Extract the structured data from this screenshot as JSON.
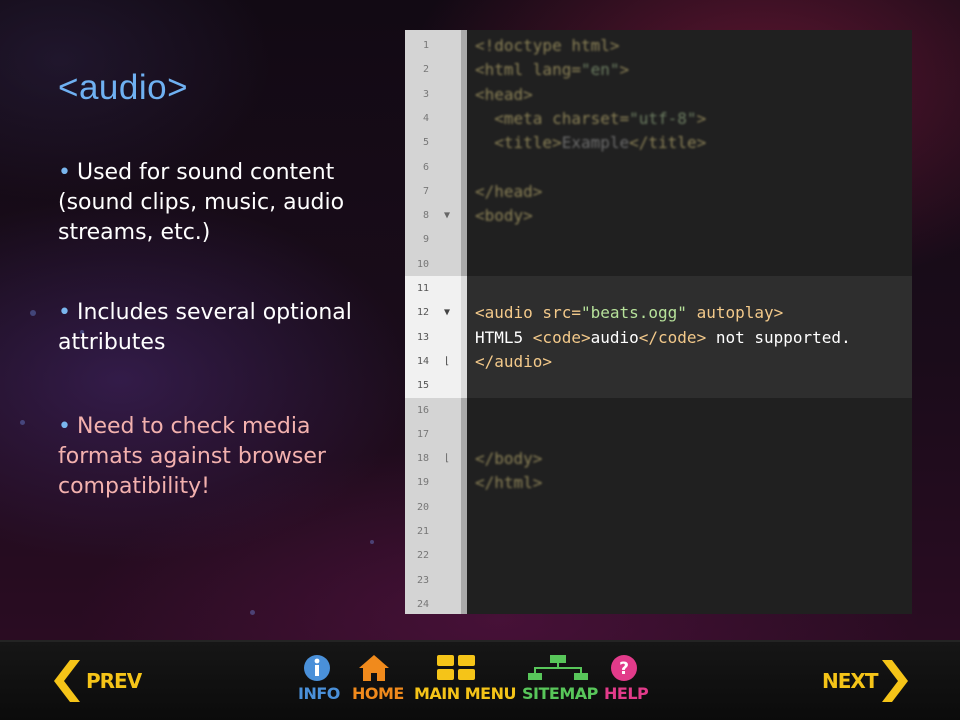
{
  "slide": {
    "title": "<audio>",
    "bullets": [
      {
        "text": "Used for sound content (sound clips, music, audio streams, etc.)"
      },
      {
        "text": "Includes several optional attributes"
      },
      {
        "text": "Need to check media formats against browser compatibility!"
      }
    ]
  },
  "code": {
    "lines": [
      {
        "n": "1",
        "fold": "",
        "text": "<!doctype html>"
      },
      {
        "n": "2",
        "fold": "",
        "text": "<html lang=\"en\">"
      },
      {
        "n": "3",
        "fold": "",
        "text": "<head>"
      },
      {
        "n": "4",
        "fold": "",
        "text": "  <meta charset=\"utf-8\">"
      },
      {
        "n": "5",
        "fold": "",
        "text": "  <title>Example</title>"
      },
      {
        "n": "6",
        "fold": "",
        "text": ""
      },
      {
        "n": "7",
        "fold": "",
        "text": "</head>"
      },
      {
        "n": "8",
        "fold": "▼",
        "text": "<body>"
      },
      {
        "n": "9",
        "fold": "",
        "text": ""
      },
      {
        "n": "10",
        "fold": "",
        "text": ""
      },
      {
        "n": "11",
        "fold": "",
        "text": ""
      },
      {
        "n": "12",
        "fold": "▼",
        "text": "<audio src=\"beats.ogg\" autoplay>"
      },
      {
        "n": "13",
        "fold": "",
        "text": "HTML5 <code>audio</code> not supported."
      },
      {
        "n": "14",
        "fold": "⌊",
        "text": "</audio>"
      },
      {
        "n": "15",
        "fold": "",
        "text": ""
      },
      {
        "n": "16",
        "fold": "",
        "text": ""
      },
      {
        "n": "17",
        "fold": "",
        "text": ""
      },
      {
        "n": "18",
        "fold": "⌊",
        "text": "</body>"
      },
      {
        "n": "19",
        "fold": "",
        "text": "</html>"
      },
      {
        "n": "20",
        "fold": "",
        "text": ""
      },
      {
        "n": "21",
        "fold": "",
        "text": ""
      },
      {
        "n": "22",
        "fold": "",
        "text": ""
      },
      {
        "n": "23",
        "fold": "",
        "text": ""
      },
      {
        "n": "24",
        "fold": "",
        "text": ""
      }
    ],
    "highlight_first": 11,
    "highlight_last": 15
  },
  "nav": {
    "prev": "PREV",
    "info": "INFO",
    "home": "HOME",
    "main_menu": "MAIN MENU",
    "sitemap": "SITEMAP",
    "help": "HELP",
    "next": "NEXT"
  },
  "colors": {
    "title": "#6fb1f2",
    "warning_text": "#f3b1ae",
    "nav_yellow": "#f5c418",
    "info_blue": "#4a90d9",
    "home_orange": "#f08a1c",
    "sitemap_green": "#58c65a",
    "help_pink": "#e23b8a"
  },
  "icons": [
    "prev-arrow-icon",
    "info-icon",
    "home-icon",
    "main-menu-grid-icon",
    "sitemap-icon",
    "help-icon",
    "next-arrow-icon"
  ]
}
